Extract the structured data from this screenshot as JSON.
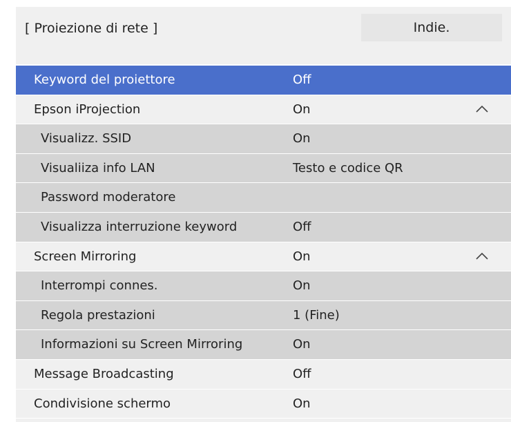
{
  "header": {
    "title": "[ Proiezione di rete ]",
    "back_label": "Indie."
  },
  "rows": [
    {
      "label": "Keyword del proiettore",
      "value": "Off"
    },
    {
      "label": "Epson iProjection",
      "value": "On"
    },
    {
      "label": "Visualizz. SSID",
      "value": "On"
    },
    {
      "label": "Visualiiza info LAN",
      "value": "Testo e codice QR"
    },
    {
      "label": "Password moderatore",
      "value": ""
    },
    {
      "label": "Visualizza interruzione keyword",
      "value": "Off"
    },
    {
      "label": "Screen Mirroring",
      "value": "On"
    },
    {
      "label": "Interrompi connes.",
      "value": "On"
    },
    {
      "label": "Regola prestazioni",
      "value": "1 (Fine)"
    },
    {
      "label": "Informazioni su Screen Mirroring",
      "value": "On"
    },
    {
      "label": "Message Broadcasting",
      "value": "Off"
    },
    {
      "label": "Condivisione schermo",
      "value": "On"
    }
  ],
  "colors": {
    "selected": "#4a6fcb",
    "main_bg": "#f0f0f0",
    "sub_bg": "#d4d4d4"
  },
  "icons": {
    "expand": "chevron-up-icon"
  }
}
